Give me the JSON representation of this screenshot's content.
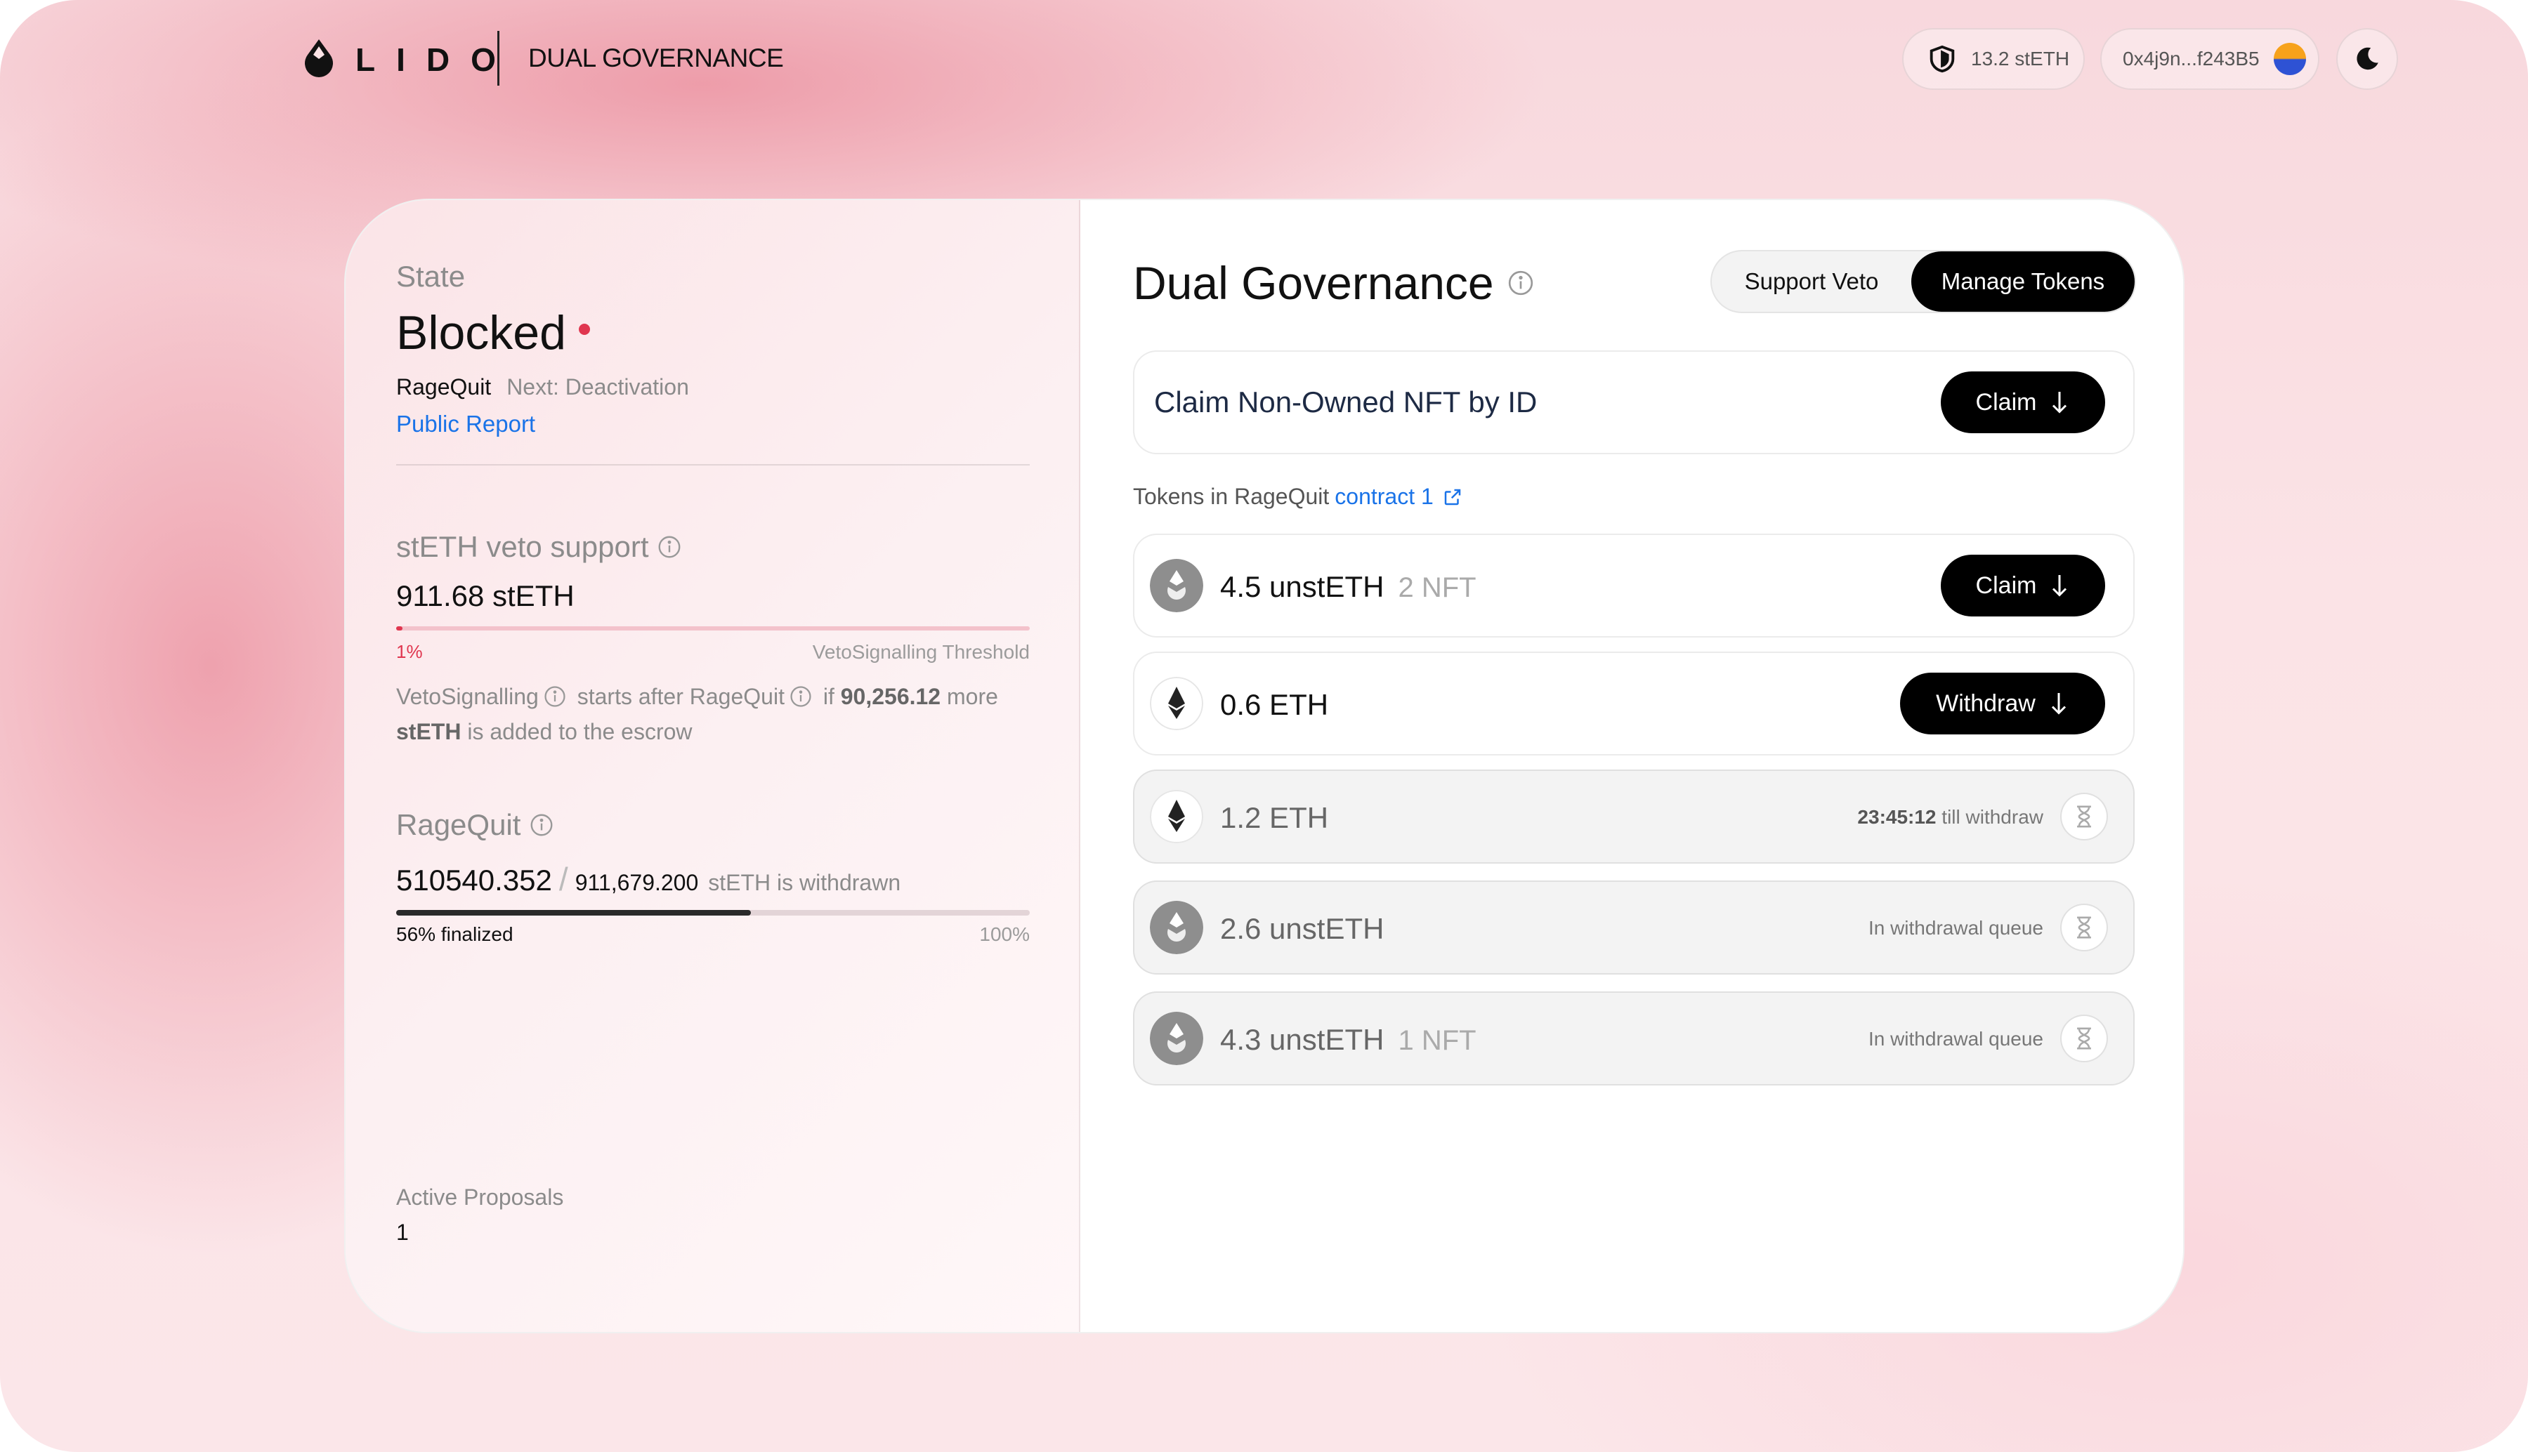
{
  "header": {
    "logo_text": "LIDO",
    "app_title": "DUAL GOVERNANCE",
    "balance": "13.2 stETH",
    "wallet_address": "0x4j9n...f243B5"
  },
  "state": {
    "label": "State",
    "value": "Blocked",
    "substate_current": "RageQuit",
    "substate_next": "Next: Deactivation",
    "public_report": "Public Report"
  },
  "veto": {
    "label": "stETH veto support",
    "value": "911.68 stETH",
    "percent_label": "1%",
    "progress": 0.01,
    "threshold_label": "VetoSignalling Threshold",
    "desc_part1": "VetoSignalling",
    "desc_part2": " starts after RageQuit",
    "desc_part3": " if ",
    "desc_amount": "90,256.12",
    "desc_part4": " more",
    "desc_token": "stETH",
    "desc_part5": " is added to the escrow"
  },
  "ragequit": {
    "label": "RageQuit",
    "withdrawn": "510540.352",
    "slash": "/",
    "total": "911,679.200",
    "suffix": "stETH is withdrawn",
    "progress": 0.56,
    "finalized_label": "56% finalized",
    "max_label": "100%"
  },
  "proposals": {
    "label": "Active Proposals",
    "value": "1"
  },
  "panel": {
    "title": "Dual Governance",
    "tab_support_veto": "Support Veto",
    "tab_manage_tokens": "Manage Tokens",
    "claim_nft_label": "Claim Non-Owned NFT by ID",
    "claim_button": "Claim",
    "tokens_caption": "Tokens in RageQuit",
    "contract_link": "contract 1"
  },
  "tokens": [
    {
      "amount": "4.5 unstETH",
      "nft": "2 NFT",
      "action": "Claim"
    },
    {
      "amount": "0.6 ETH",
      "nft": "",
      "action": "Withdraw"
    },
    {
      "amount": "1.2 ETH",
      "nft": "",
      "status_time": "23:45:12",
      "status_text": " till withdraw"
    },
    {
      "amount": "2.6 unstETH",
      "nft": "",
      "status_text": "In withdrawal queue"
    },
    {
      "amount": "4.3 unstETH",
      "nft": "1 NFT",
      "status_text": "In withdrawal queue"
    }
  ],
  "colors": {
    "accent_red": "#e0364f",
    "link_blue": "#1a73e8",
    "button_black": "#000000"
  },
  "icons": [
    "lido-drop-icon",
    "shield-icon",
    "moon-icon",
    "info-icon",
    "arrow-down-icon",
    "external-link-icon",
    "steth-icon",
    "eth-icon",
    "hourglass-icon"
  ]
}
